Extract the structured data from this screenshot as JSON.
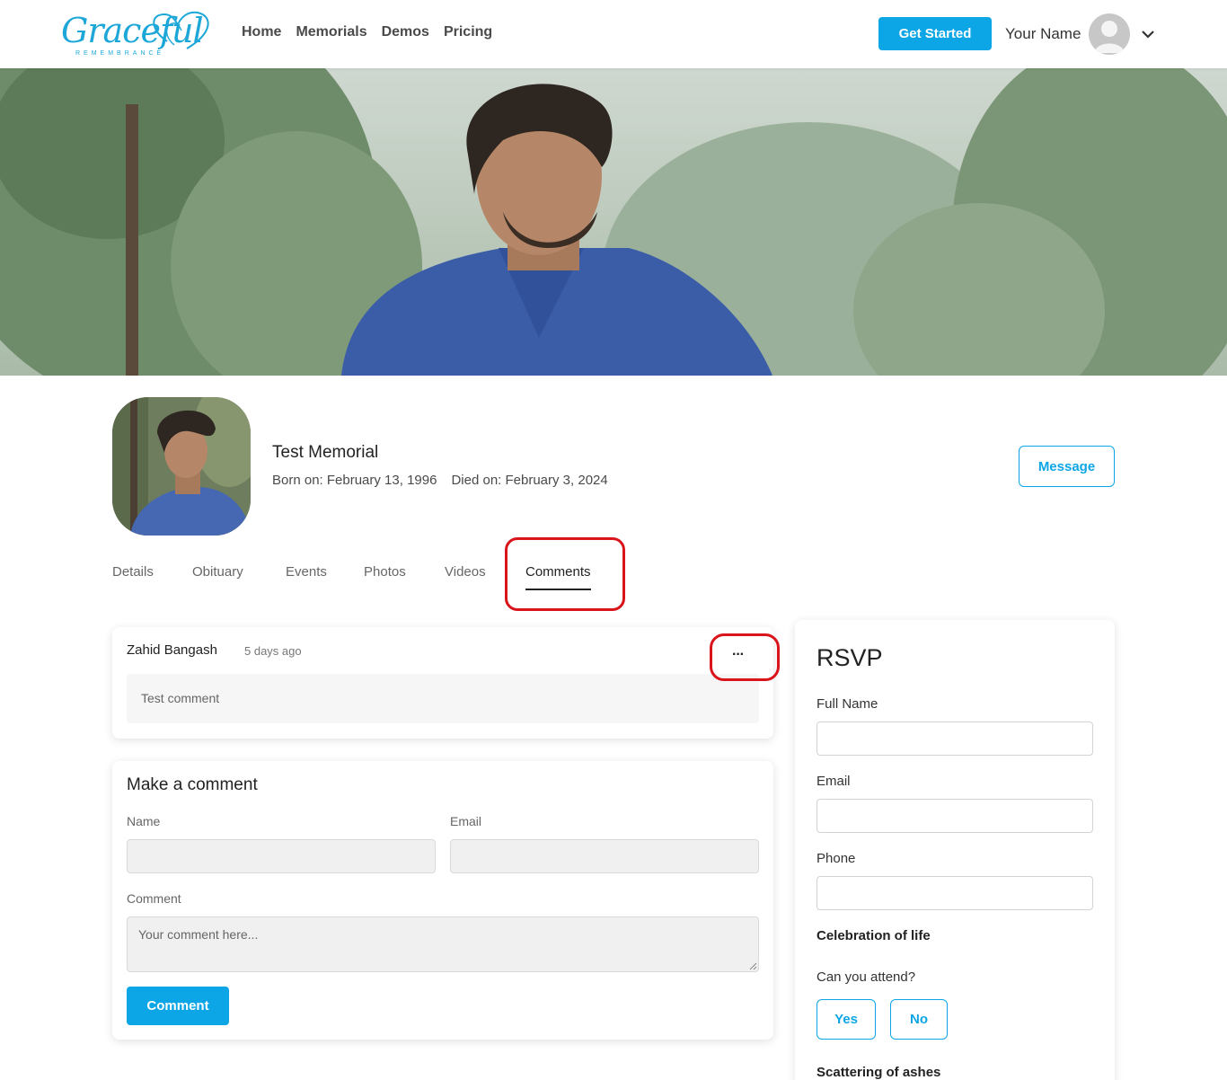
{
  "header": {
    "logo_text": "Graceful",
    "logo_subtext": "REMEMBRANCE",
    "nav": [
      "Home",
      "Memorials",
      "Demos",
      "Pricing"
    ],
    "get_started_label": "Get Started",
    "user_name": "Your Name"
  },
  "memorial": {
    "title": "Test Memorial",
    "born": "Born on: February 13, 1996",
    "died": "Died on: February 3, 2024",
    "message_label": "Message"
  },
  "tabs": [
    "Details",
    "Obituary",
    "Events",
    "Photos",
    "Videos",
    "Comments"
  ],
  "active_tab": "Comments",
  "comment": {
    "author": "Zahid Bangash",
    "time": "5 days ago",
    "more_label": "···",
    "body": "Test comment"
  },
  "make_comment": {
    "title": "Make a comment",
    "name_label": "Name",
    "email_label": "Email",
    "comment_label": "Comment",
    "comment_placeholder": "Your comment here...",
    "submit_label": "Comment"
  },
  "rsvp": {
    "title": "RSVP",
    "full_name_label": "Full Name",
    "email_label": "Email",
    "phone_label": "Phone",
    "event_title": "Celebration of life",
    "attend_question": "Can you attend?",
    "yes_label": "Yes",
    "no_label": "No",
    "next_event_title": "Scattering of ashes"
  },
  "colors": {
    "accent": "#0ca6e6",
    "highlight": "#d9151b"
  }
}
